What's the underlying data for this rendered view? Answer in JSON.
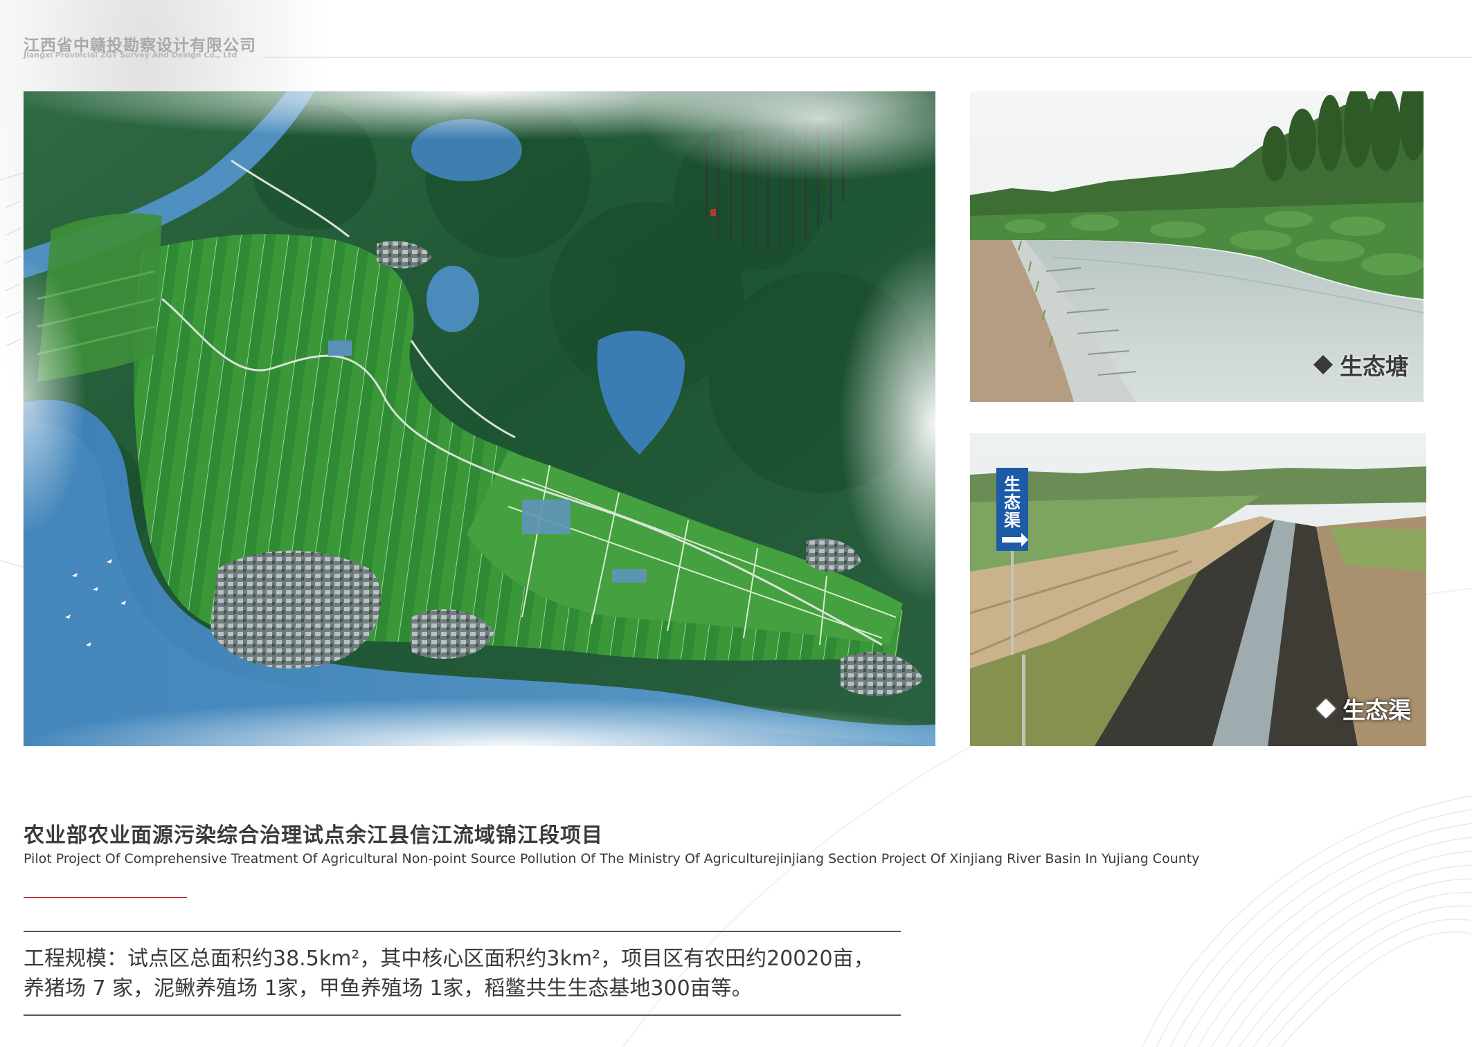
{
  "header": {
    "company_cn": "江西省中赣投勘察设计有限公司",
    "company_en": "Jiangxi Provincial ZGT Survey And Design Co., Ltd"
  },
  "photos": {
    "pond_caption": "生态塘",
    "canal_caption": "生态渠",
    "canal_sign_text": "生态渠"
  },
  "project": {
    "title_cn": "农业部农业面源污染综合治理试点余江县信江流域锦江段项目",
    "title_en": "Pilot Project Of Comprehensive Treatment Of Agricultural Non-point Source Pollution Of The Ministry Of Agriculturejinjiang Section Project Of Xinjiang River Basin In Yujiang County",
    "description_line1": "工程规模：试点区总面积约38.5km²，其中核心区面积约3km²，项目区有农田约20020亩，",
    "description_line2": "养猪场 7 家，泥鳅养殖场 1家，甲鱼养殖场 1家，稻鳖共生生态基地300亩等。"
  },
  "colors": {
    "accent_red": "#c0393b",
    "company_gray": "#a9a9a9",
    "text_dark": "#3a3a3a"
  }
}
